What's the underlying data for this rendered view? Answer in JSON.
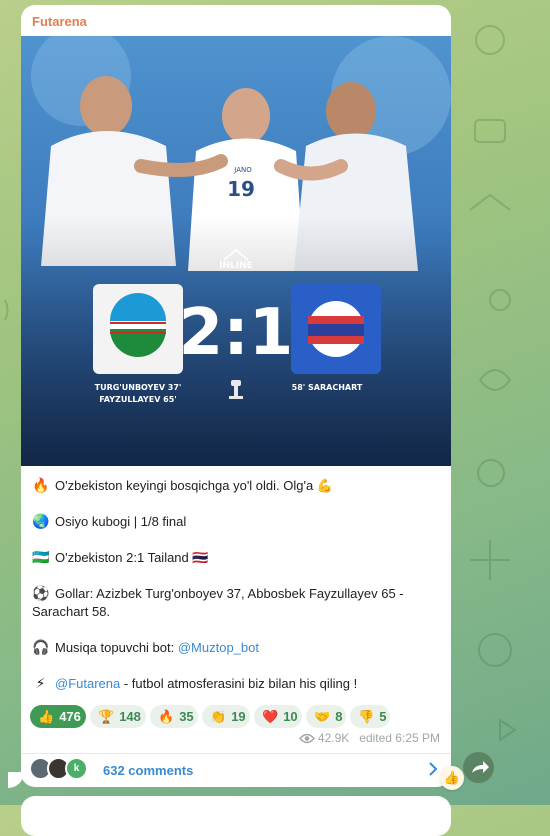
{
  "channel": {
    "name": "Futarena"
  },
  "photo": {
    "score": "2:1",
    "home_scorers": [
      "TURG'UNBOYEV 37'",
      "FAYZULLAYEV 65'"
    ],
    "away_scorers": [
      "58' SARACHART"
    ],
    "logo_text": "INLINE",
    "player_name": "JANO",
    "player_number": "19"
  },
  "post": {
    "lines": [
      {
        "emoji": "🔥",
        "text": "O'zbekiston keyingi bosqichga yo'l oldi. Olg'a 💪"
      },
      {
        "emoji": "🌏",
        "text": "Osiyo kubogi | 1/8 final"
      },
      {
        "emoji": "🇺🇿",
        "text": "O'zbekiston 2:1 Tailand 🇹🇭"
      },
      {
        "emoji": "⚽",
        "text": "Gollar: Azizbek Turg'onboyev 37, Abbosbek Fayzullayev 65 - Sarachart 58."
      },
      {
        "emoji": "🎧",
        "text": "Musiqa topuvchi bot: ",
        "link": "@Muztop_bot"
      },
      {
        "emoji": "⚡",
        "link": "@Futarena",
        "text": " - futbol atmosferasini biz bilan his qiling !"
      }
    ]
  },
  "reactions": [
    {
      "emoji": "👍",
      "count": "476"
    },
    {
      "emoji": "🏆",
      "count": "148"
    },
    {
      "emoji": "🔥",
      "count": "35"
    },
    {
      "emoji": "👏",
      "count": "19"
    },
    {
      "emoji": "❤️",
      "count": "10"
    },
    {
      "emoji": "🤝",
      "count": "8"
    },
    {
      "emoji": "👎",
      "count": "5"
    }
  ],
  "meta": {
    "views": "42.9K",
    "edited": "edited 6:25 PM"
  },
  "comments": {
    "label": "632 comments",
    "avatar_letter": "k"
  },
  "mini_reaction": "👍",
  "colors": {
    "channel": "#e17f53",
    "link": "#3a8ad1",
    "reaction_bg": "#e9f1ea",
    "reaction_text": "#3e8a55"
  }
}
